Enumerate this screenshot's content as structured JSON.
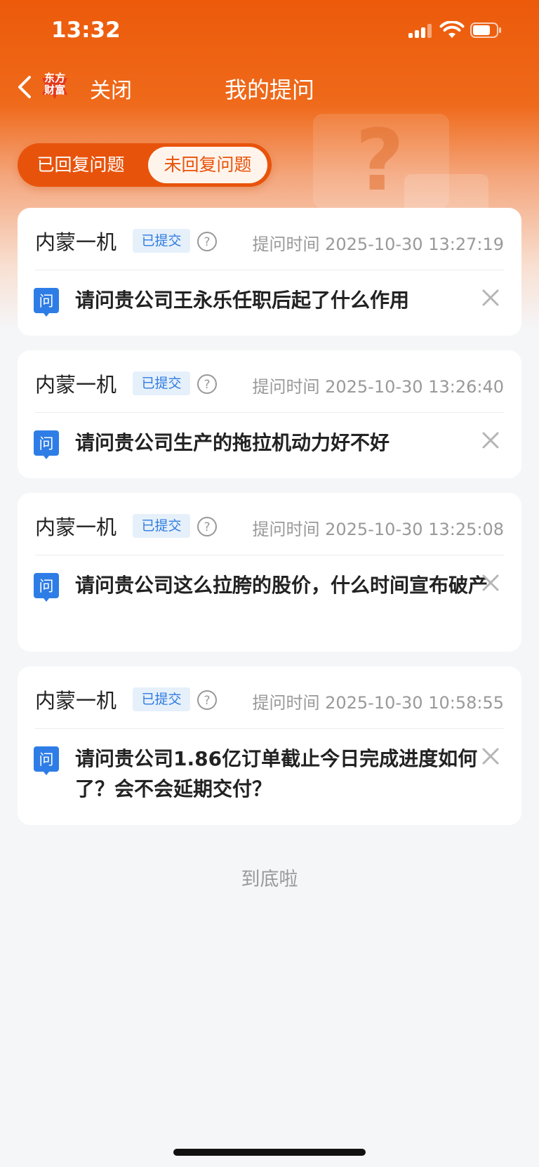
{
  "status_bar": {
    "time": "13:32"
  },
  "nav": {
    "close_label": "关闭",
    "title": "我的提问",
    "logo_text_line1": "东方",
    "logo_text_line2": "财富"
  },
  "tabs": [
    {
      "label": "已回复问题",
      "active": false
    },
    {
      "label": "未回复问题",
      "active": true
    }
  ],
  "questions": [
    {
      "company": "内蒙一机",
      "status": "已提交",
      "time": "提问时间 2025-10-30 13:27:19",
      "icon_label": "问",
      "text": "请问贵公司王永乐任职后起了什么作用"
    },
    {
      "company": "内蒙一机",
      "status": "已提交",
      "time": "提问时间 2025-10-30 13:26:40",
      "icon_label": "问",
      "text": "请问贵公司生产的拖拉机动力好不好"
    },
    {
      "company": "内蒙一机",
      "status": "已提交",
      "time": "提问时间 2025-10-30 13:25:08",
      "icon_label": "问",
      "text": "请问贵公司这么拉胯的股价，什么时间宣布破产"
    },
    {
      "company": "内蒙一机",
      "status": "已提交",
      "time": "提问时间 2025-10-30 10:58:55",
      "icon_label": "问",
      "text": "请问贵公司1.86亿订单截止今日完成进度如何了？会不会延期交付？"
    }
  ],
  "footer": {
    "end_text": "到底啦"
  },
  "colors": {
    "brand_orange": "#e8530b",
    "badge_blue": "#2f7be0",
    "question_icon_blue": "#2e7de6"
  }
}
